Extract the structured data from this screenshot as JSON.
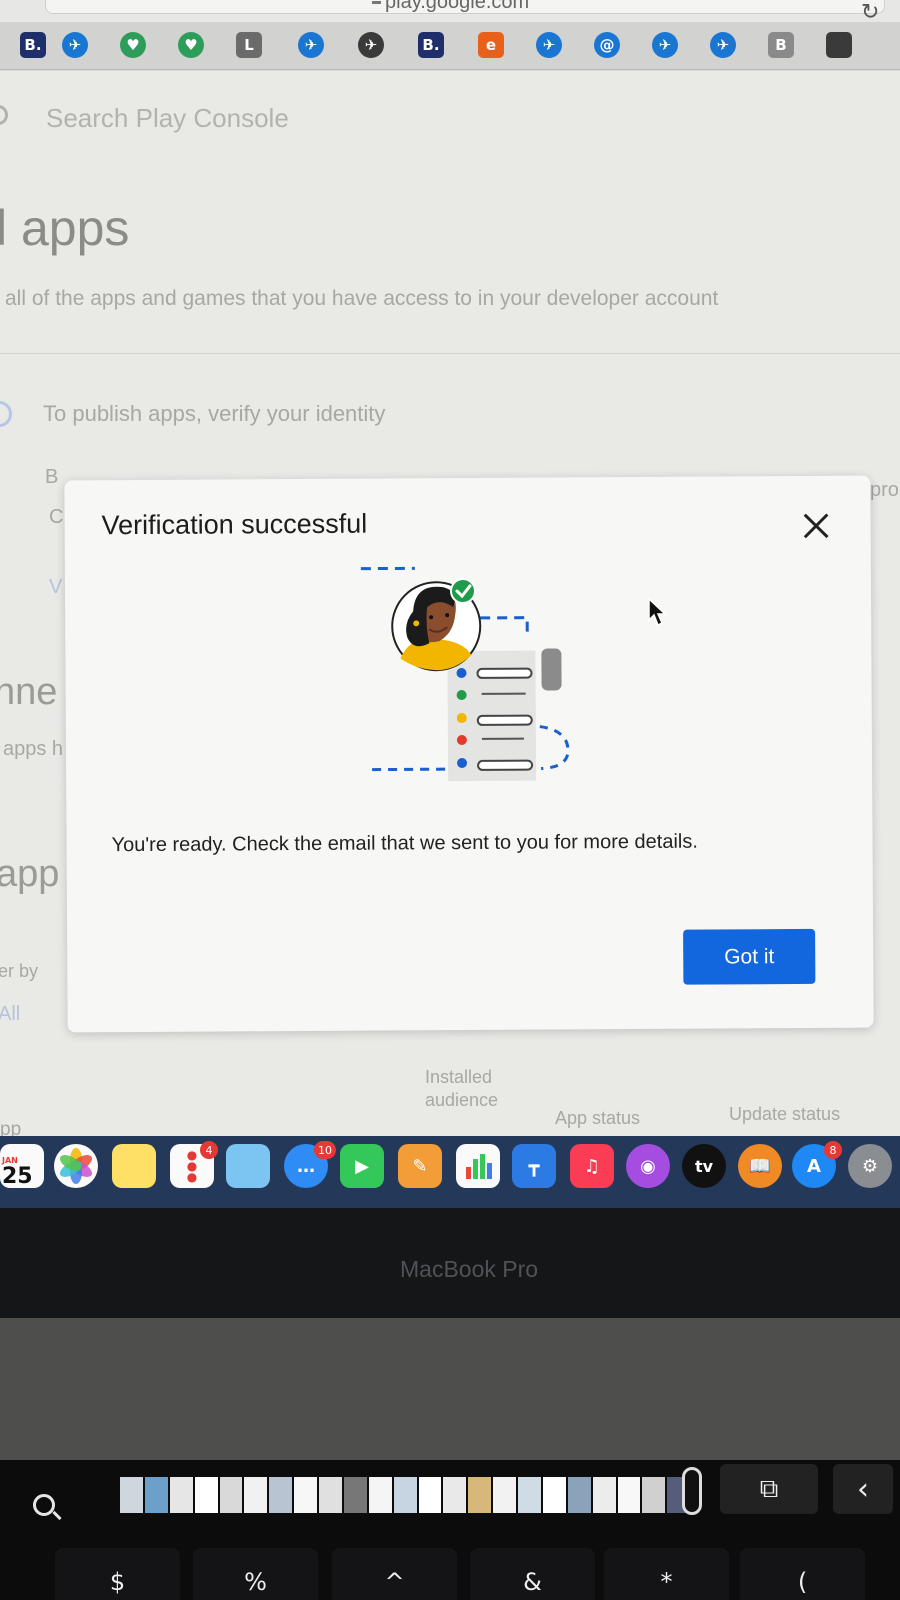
{
  "browser": {
    "url": "play.google.com",
    "bookmarks": [
      {
        "label": "B.",
        "icon": "booking-icon",
        "color": "#1f2f6b"
      },
      {
        "label": "✈",
        "icon": "plane-icon",
        "color": "#1976d2"
      },
      {
        "label": "♥",
        "icon": "heart-check-icon",
        "color": "#2e9d5a"
      },
      {
        "label": "♥",
        "icon": "heart-check-icon",
        "color": "#2e9d5a"
      },
      {
        "label": "L",
        "icon": "letter-l-icon",
        "color": "#6b6b6b"
      },
      {
        "label": "✈",
        "icon": "plane-icon",
        "color": "#1976d2"
      },
      {
        "label": "✈",
        "icon": "airline-logo-icon",
        "color": "#3a3a3a"
      },
      {
        "label": "B.",
        "icon": "booking-icon",
        "color": "#1f2f6b"
      },
      {
        "label": "e",
        "icon": "e-icon",
        "color": "#e8611a"
      },
      {
        "label": "✈",
        "icon": "plane-icon",
        "color": "#1976d2"
      },
      {
        "label": "@",
        "icon": "at-icon",
        "color": "#1976d2"
      },
      {
        "label": "✈",
        "icon": "plane-icon",
        "color": "#1976d2"
      },
      {
        "label": "✈",
        "icon": "plane-icon",
        "color": "#1976d2"
      },
      {
        "label": "B",
        "icon": "letter-b-icon",
        "color": "#8a8a8a"
      },
      {
        "label": "",
        "icon": "apple-icon",
        "color": "#3a3a3a"
      }
    ]
  },
  "page": {
    "search_placeholder": "Search Play Console",
    "title": "l apps",
    "subtitle": "all of the apps and games that you have access to in your developer account",
    "verify_banner": "To publish apps, verify your identity",
    "fragments": {
      "b": "B",
      "c": "C",
      "v": "V",
      "pro": "pro",
      "nne": "nne",
      "apps_h": "apps h",
      "app": "app",
      "er_by": "er by",
      "all": "All",
      "pp": "pp"
    },
    "columns": {
      "installed_audience": "Installed audience",
      "app_status": "App status",
      "update_status": "Update status"
    }
  },
  "modal": {
    "title": "Verification successful",
    "body": "You're ready. Check the email that we sent to you for more details.",
    "button": "Got it",
    "colors": {
      "button": "#1266de",
      "check": "#1e9c4a",
      "avatar_shirt": "#f2b600"
    }
  },
  "dock": {
    "calendar": {
      "month": "JAN",
      "day": "25"
    },
    "items": [
      {
        "icon": "calendar-icon",
        "color": "#ffffff"
      },
      {
        "icon": "photos-icon",
        "color": "#ffffff"
      },
      {
        "icon": "notes-icon",
        "color": "#ffe066"
      },
      {
        "icon": "reminders-icon",
        "color": "#ffffff",
        "badge": "4"
      },
      {
        "icon": "maps-icon",
        "color": "#7cc4f2"
      },
      {
        "icon": "messages-icon",
        "color": "#2f8cf5",
        "badge": "10"
      },
      {
        "icon": "facetime-icon",
        "color": "#34c759"
      },
      {
        "icon": "pages-icon",
        "color": "#f29d38"
      },
      {
        "icon": "numbers-icon",
        "color": "#34c759"
      },
      {
        "icon": "keynote-icon",
        "color": "#2c7be5"
      },
      {
        "icon": "music-icon",
        "color": "#fa3c55"
      },
      {
        "icon": "podcasts-icon",
        "color": "#a54de0"
      },
      {
        "icon": "apple-tv-icon",
        "color": "#111111",
        "label": "tv"
      },
      {
        "icon": "books-icon",
        "color": "#f08a24"
      },
      {
        "icon": "app-store-icon",
        "color": "#1e88f5",
        "badge": "8"
      },
      {
        "icon": "system-preferences-icon",
        "color": "#8a8d92"
      }
    ]
  },
  "laptop": {
    "label": "MacBook Pro",
    "touchbar_tabs_glyph": "⧉",
    "touchbar_back_glyph": "‹",
    "keys": [
      "$",
      "%",
      "^",
      "&",
      "*",
      "("
    ]
  }
}
